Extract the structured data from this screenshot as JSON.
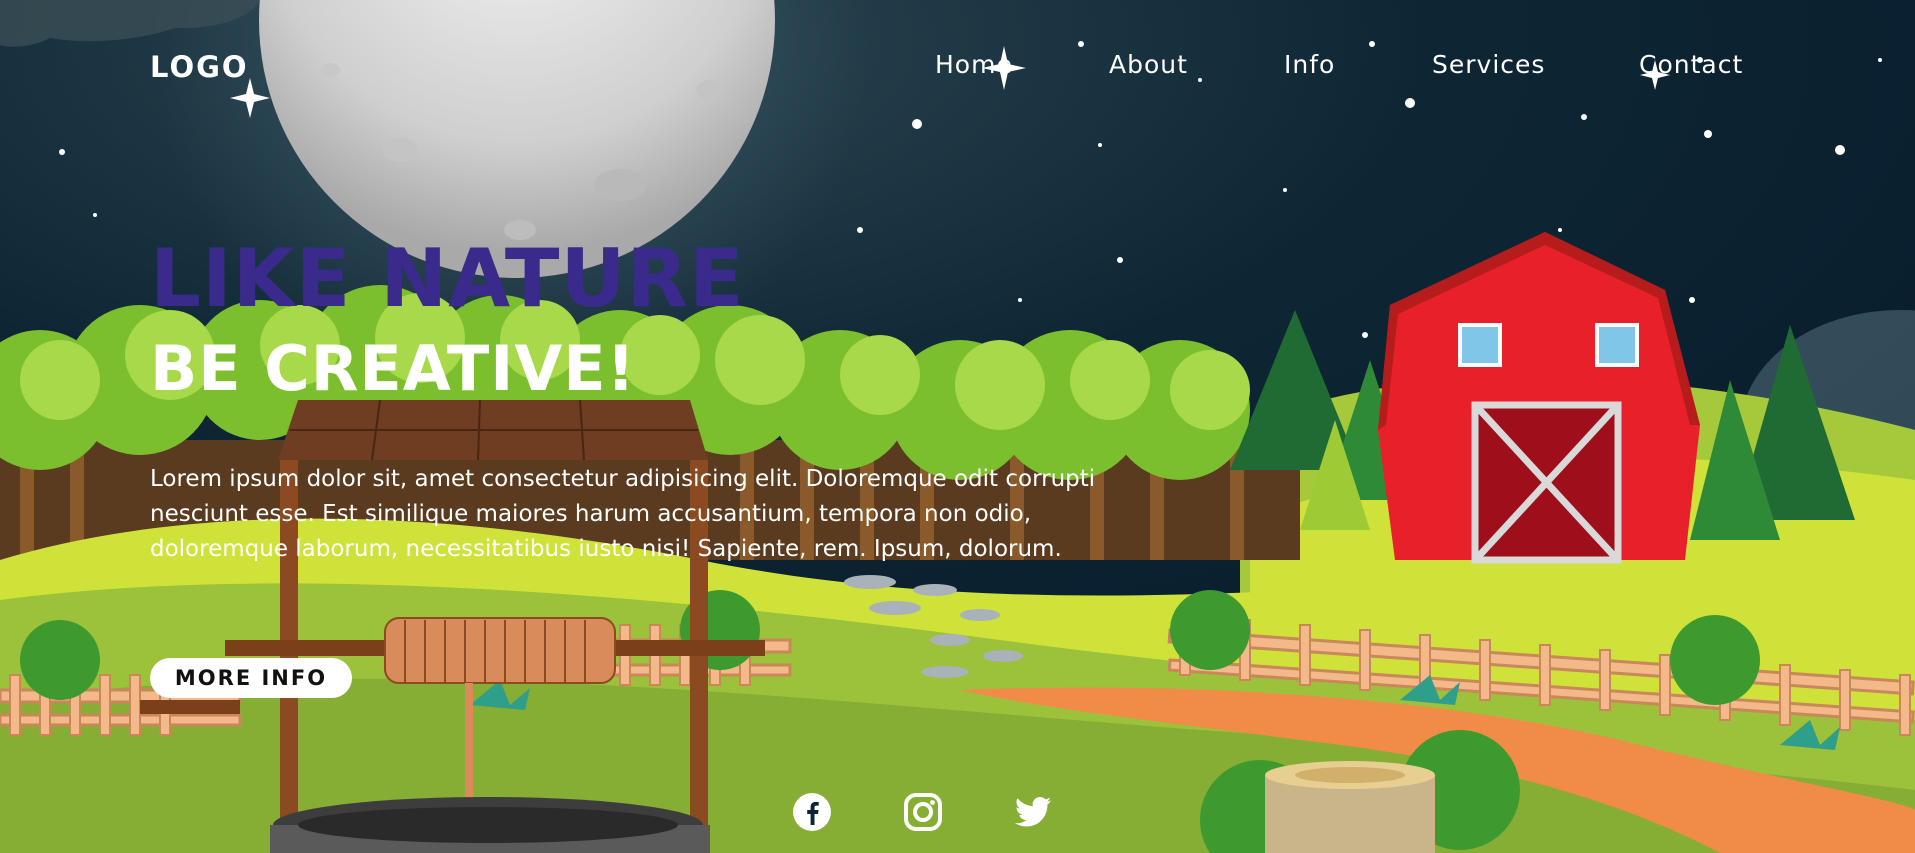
{
  "brand": {
    "logo": "LOGO"
  },
  "nav": {
    "items": [
      {
        "label": "Home"
      },
      {
        "label": "About"
      },
      {
        "label": "Info"
      },
      {
        "label": "Services"
      },
      {
        "label": "Contact"
      }
    ]
  },
  "hero": {
    "title_line_1": "LIKE NATURE",
    "title_line_2": "BE CREATIVE!",
    "paragraph": "Lorem ipsum dolor sit, amet consectetur adipisicing elit. Doloremque odit corrupti nesciunt esse. Est similique maiores harum accusantium, tempora non odio, doloremque laborum, necessitatibus iusto nisi! Sapiente, rem. Ipsum, dolorum.",
    "cta_label": "MORE INFO"
  },
  "social": [
    {
      "icon": "facebook-icon"
    },
    {
      "icon": "instagram-icon"
    },
    {
      "icon": "twitter-icon"
    }
  ],
  "colors": {
    "sky": "#0a1d2c",
    "title_accent": "#3a2a8c",
    "barn": "#e8202a",
    "grass": "#8ab63a"
  }
}
